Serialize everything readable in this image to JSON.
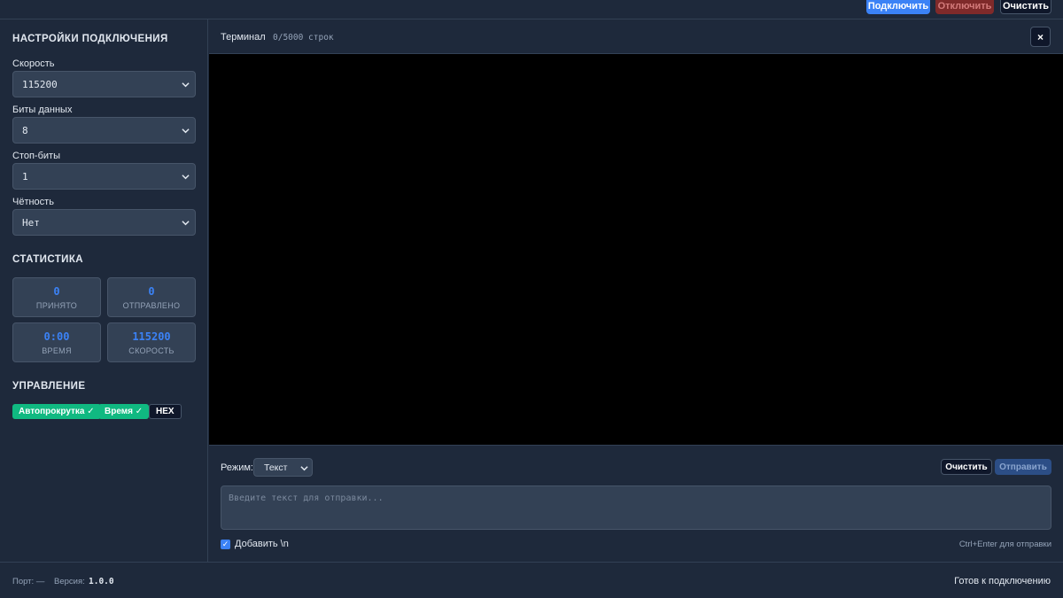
{
  "toolbar": {
    "connect_label": "Подключить",
    "disconnect_label": "Отключить",
    "clear_label": "Очистить"
  },
  "settings": {
    "title": "НАСТРОЙКИ ПОДКЛЮЧЕНИЯ",
    "baud_label": "Скорость",
    "baud_value": "115200",
    "databits_label": "Биты данных",
    "databits_value": "8",
    "stopbits_label": "Стоп-биты",
    "stopbits_value": "1",
    "parity_label": "Чётность",
    "parity_value": "Нет"
  },
  "stats": {
    "title": "СТАТИСТИКА",
    "received_value": "0",
    "received_label": "ПРИНЯТО",
    "sent_value": "0",
    "sent_label": "ОТПРАВЛЕНО",
    "time_value": "0:00",
    "time_label": "ВРЕМЯ",
    "speed_value": "115200",
    "speed_label": "СКОРОСТЬ"
  },
  "control": {
    "title": "УПРАВЛЕНИЕ",
    "autoscroll_label": "Автопрокрутка ✓",
    "timestamp_label": "Время ✓",
    "hex_label": "HEX"
  },
  "terminal": {
    "title": "Терминал",
    "lines": "0/5000 строк",
    "close_label": "×"
  },
  "send": {
    "mode_label": "Режим:",
    "mode_value": "Текст",
    "clear_label": "Очистить",
    "send_label": "Отправить",
    "placeholder": "Введите текст для отправки...",
    "append_newline_label": "Добавить \\n",
    "hint": "Ctrl+Enter для отправки"
  },
  "footer": {
    "port": "Порт: —",
    "version_label": "Версия:",
    "version_value": "1.0.0",
    "status": "Готов к подключению"
  },
  "colors": {
    "accent": "#3b82f6",
    "success": "#10b981",
    "danger": "#7f2a2a",
    "background": "#1e293b"
  }
}
